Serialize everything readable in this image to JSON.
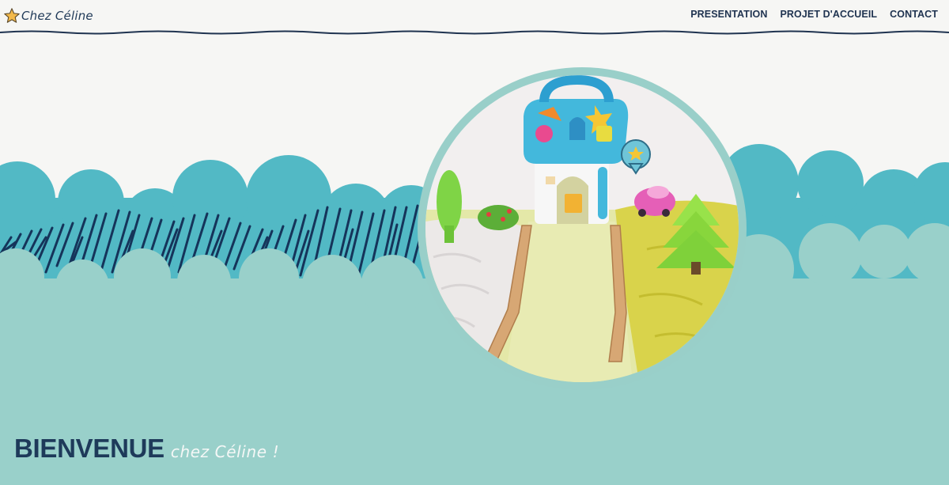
{
  "brand": {
    "name": "Chez Céline",
    "icon": "star-icon"
  },
  "nav": {
    "items": [
      {
        "label": "PRESENTATION"
      },
      {
        "label": "PROJET D'ACCUEIL"
      },
      {
        "label": "CONTACT"
      }
    ]
  },
  "hero": {
    "title": "BIENVENUE",
    "subtitle": "chez Céline !"
  },
  "colors": {
    "background": "#f6f6f4",
    "navy": "#1e3a5a",
    "teal_dark": "#52b9c5",
    "teal_light": "#99d0ca",
    "star": "#f3b94a"
  }
}
